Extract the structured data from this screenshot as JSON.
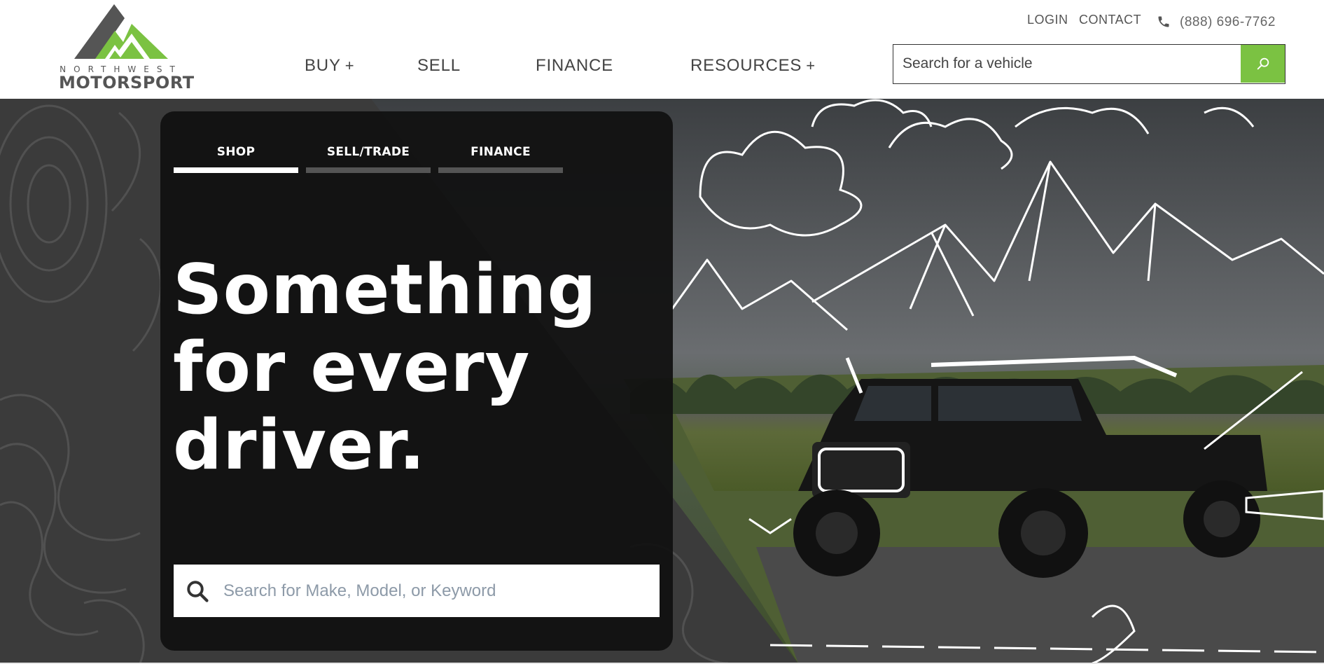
{
  "brand": {
    "logo_line1": "NORTHWEST",
    "logo_line2": "MOTORSPORT",
    "logo_icon": "mountain-logo-icon",
    "accent_color": "#7bc242"
  },
  "utility": {
    "login": "LOGIN",
    "contact": "CONTACT",
    "phone": "(888) 696-7762",
    "phone_icon": "phone-icon"
  },
  "nav": {
    "buy": "BUY",
    "sell": "SELL",
    "finance": "FINANCE",
    "resources": "RESOURCES",
    "plus": "+"
  },
  "header_search": {
    "placeholder": "Search for a vehicle",
    "button_icon": "search-icon"
  },
  "hero": {
    "tabs": [
      {
        "label": "SHOP",
        "active": true
      },
      {
        "label": "SELL/TRADE",
        "active": false
      },
      {
        "label": "FINANCE",
        "active": false
      }
    ],
    "headline": [
      "Something",
      "for every",
      "driver."
    ],
    "search": {
      "placeholder": "Search for Make, Model, or Keyword",
      "icon": "search-icon"
    },
    "background": "jeep-gladiator-in-meadow-with-mountain-doodles"
  }
}
